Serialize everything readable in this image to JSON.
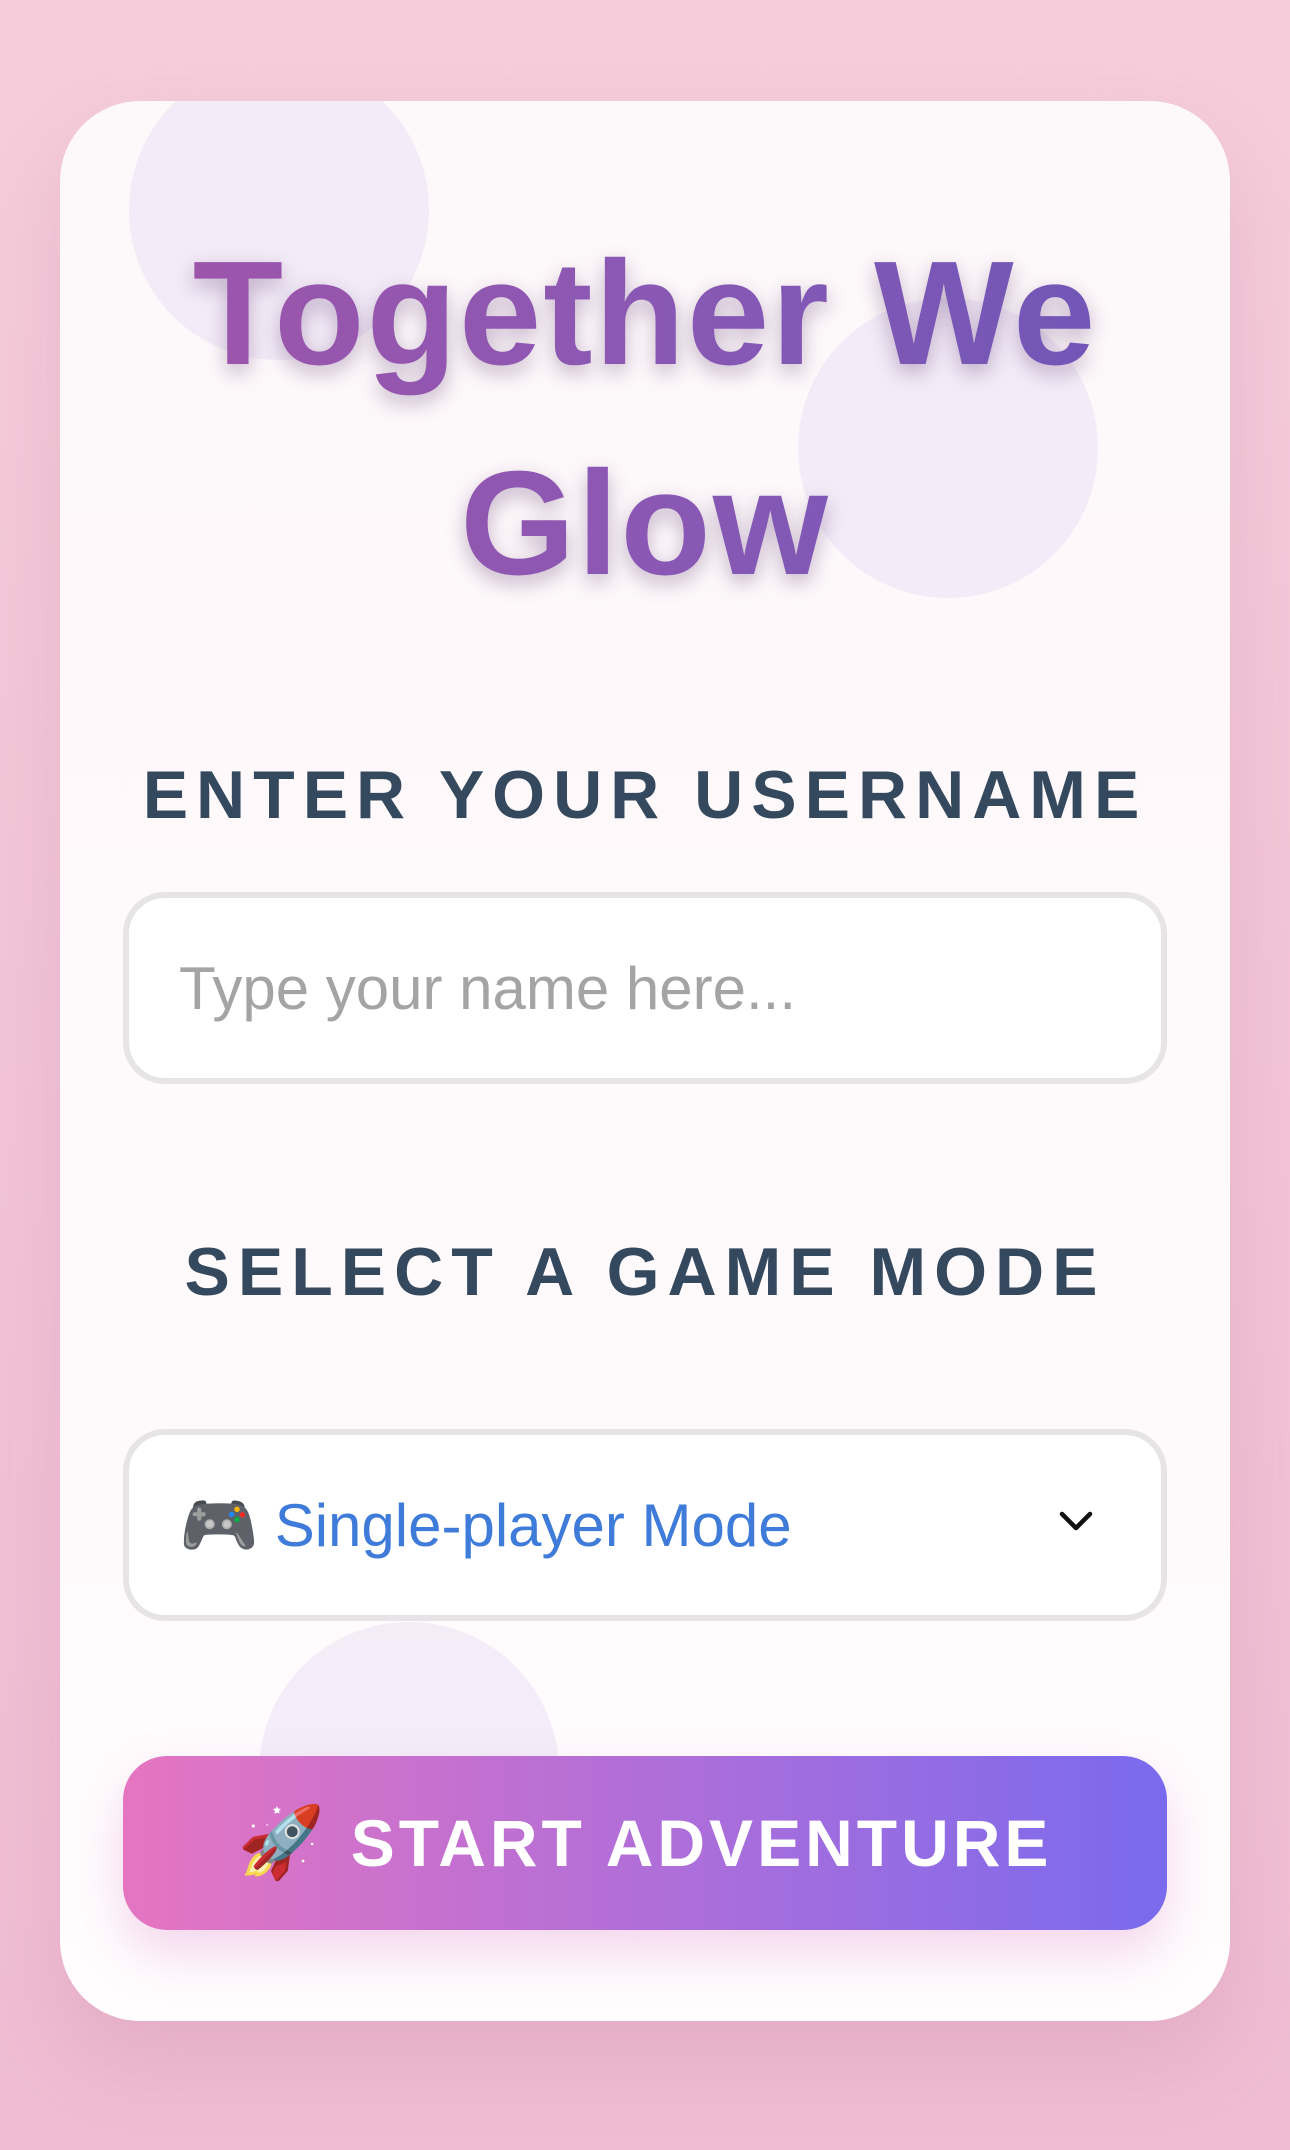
{
  "title": "Together We Glow",
  "username": {
    "label": "ENTER YOUR USERNAME",
    "placeholder": "Type your name here...",
    "value": ""
  },
  "game_mode": {
    "label": "SELECT A GAME MODE",
    "selected_icon": "🎮",
    "selected_icon_name": "gamepad-icon",
    "selected_value": "Single-player Mode",
    "dropdown_icon_name": "chevron-down-icon"
  },
  "start_button": {
    "icon": "🚀",
    "icon_name": "rocket-icon",
    "label": "START ADVENTURE"
  },
  "colors": {
    "background": "#f5cdda",
    "title_gradient_start": "#a154a8",
    "title_gradient_end": "#6a56b8",
    "label_text": "#34495e",
    "selected_mode_text": "#3f7bd9",
    "button_gradient_start": "#e575c1",
    "button_gradient_end": "#7a6aed"
  }
}
